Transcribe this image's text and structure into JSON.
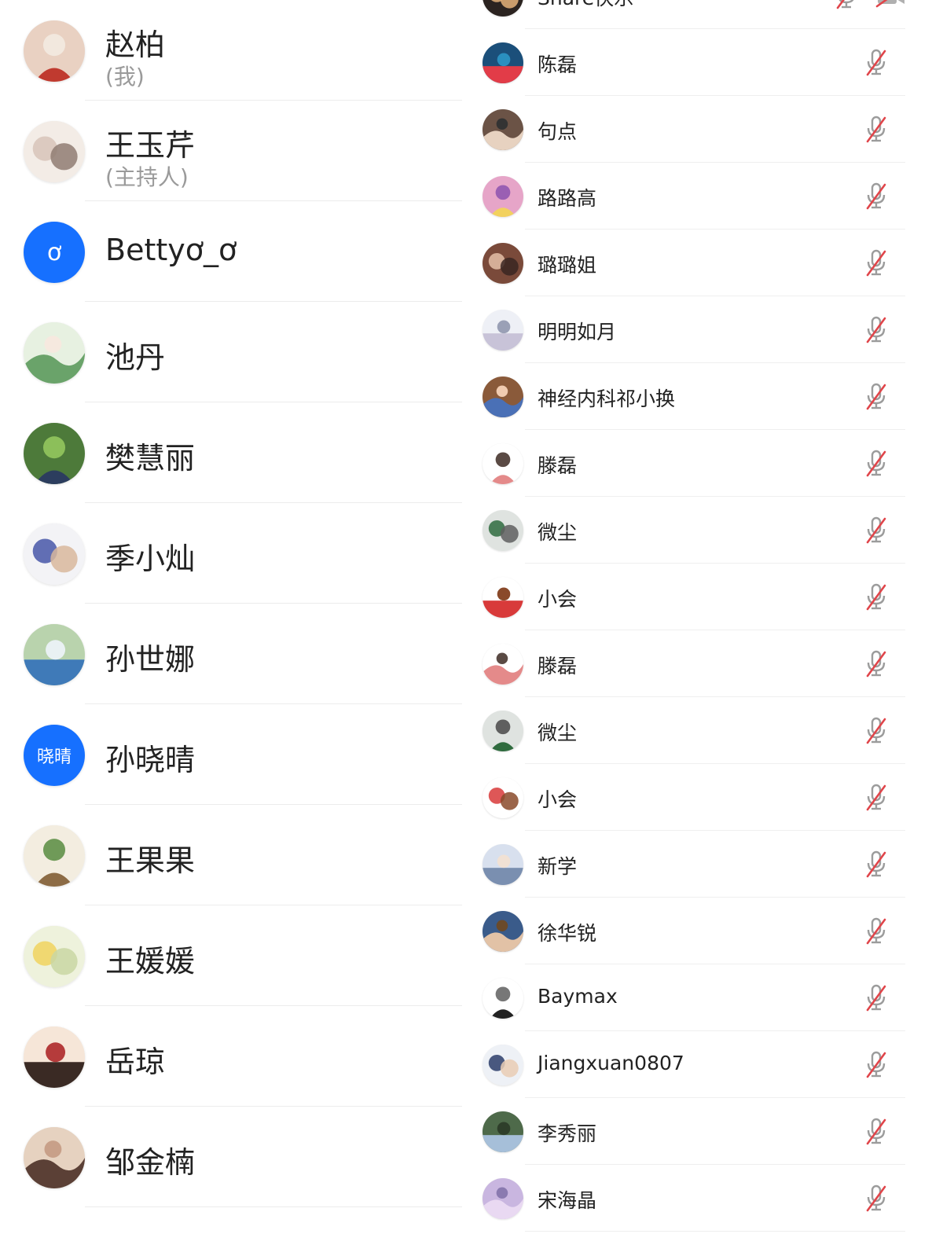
{
  "left_participants": [
    {
      "name": "赵柏",
      "role": "(我)",
      "avatar_colors": [
        "#e9d1c2",
        "#c03a2f",
        "#f2e8de"
      ]
    },
    {
      "name": "王玉芹",
      "role": "(主持人)",
      "avatar_colors": [
        "#f3ece6",
        "#d7c4b9",
        "#8f7d72"
      ]
    },
    {
      "name": "Bettyơ_ơ",
      "avatar_text": "ơ",
      "avatar_colors": [
        "#1670ff"
      ]
    },
    {
      "name": "池丹",
      "avatar_colors": [
        "#e7f1e1",
        "#6aa36a",
        "#f6e9df"
      ]
    },
    {
      "name": "樊慧丽",
      "avatar_colors": [
        "#4d7a3a",
        "#2c3d5e",
        "#8cbf5a"
      ]
    },
    {
      "name": "季小灿",
      "avatar_colors": [
        "#f3f3f6",
        "#4656a8",
        "#d8b79c"
      ]
    },
    {
      "name": "孙世娜",
      "avatar_colors": [
        "#b9d3ad",
        "#3f7ab8",
        "#e9f1f3"
      ]
    },
    {
      "name": "孙晓晴",
      "avatar_text": "晓晴",
      "avatar_colors": [
        "#1670ff"
      ]
    },
    {
      "name": "王果果",
      "avatar_colors": [
        "#f3ede0",
        "#8c6b45",
        "#6f9a58"
      ]
    },
    {
      "name": "王媛媛",
      "avatar_colors": [
        "#eef2dc",
        "#f0d35e",
        "#c9d7a3"
      ]
    },
    {
      "name": "岳琼",
      "avatar_colors": [
        "#f6e6d8",
        "#3a2a24",
        "#b53b3b"
      ]
    },
    {
      "name": "邹金楠",
      "avatar_colors": [
        "#e6d2c0",
        "#5b4036",
        "#c8a089"
      ]
    }
  ],
  "right_participants": [
    {
      "name": "Share快乐",
      "avatar_colors": [
        "#2b2320",
        "#e5b27a"
      ]
    },
    {
      "name": "陈磊",
      "avatar_colors": [
        "#1b4f7a",
        "#e23c48",
        "#2a8fbf"
      ]
    },
    {
      "name": "句点",
      "avatar_colors": [
        "#6b5346",
        "#e7d2c0",
        "#333333"
      ]
    },
    {
      "name": "路路高",
      "avatar_colors": [
        "#e6a5c8",
        "#f2d15e",
        "#9a5fb3"
      ]
    },
    {
      "name": "璐璐姐",
      "avatar_colors": [
        "#7a4a3a",
        "#e5c0a8",
        "#3a2622"
      ]
    },
    {
      "name": "明明如月",
      "avatar_colors": [
        "#eef0f6",
        "#c8c3d8",
        "#9aa0b6"
      ]
    },
    {
      "name": "神经内科祁小换",
      "avatar_colors": [
        "#8a5a3a",
        "#4a70b6",
        "#f0cbb0"
      ]
    },
    {
      "name": "滕磊",
      "avatar_colors": [
        "#ffffff",
        "#e48a8a",
        "#5a4a44"
      ]
    },
    {
      "name": "微尘",
      "avatar_colors": [
        "#dfe3e0",
        "#2f6b3e",
        "#5f5f5f"
      ]
    },
    {
      "name": "小会",
      "avatar_colors": [
        "#ffffff",
        "#d83a3a",
        "#8a4a2a"
      ]
    },
    {
      "name": "滕磊",
      "avatar_colors": [
        "#ffffff",
        "#e48a8a",
        "#5a4a44"
      ]
    },
    {
      "name": "微尘",
      "avatar_colors": [
        "#dfe3e0",
        "#2f6b3e",
        "#5f5f5f"
      ]
    },
    {
      "name": "小会",
      "avatar_colors": [
        "#ffffff",
        "#d83a3a",
        "#8a4a2a"
      ]
    },
    {
      "name": "新学",
      "avatar_colors": [
        "#d8e0ee",
        "#7a8fb0",
        "#f1e1d4"
      ]
    },
    {
      "name": "徐华锐",
      "avatar_colors": [
        "#3a5b8a",
        "#e2c2a6",
        "#6a4a2a"
      ]
    },
    {
      "name": "Baymax",
      "avatar_colors": [
        "#ffffff",
        "#222222",
        "#777777"
      ]
    },
    {
      "name": "Jiangxuan0807",
      "avatar_colors": [
        "#eef1f6",
        "#2c3d6a",
        "#e9cdb4"
      ]
    },
    {
      "name": "李秀丽",
      "avatar_colors": [
        "#4e6a4a",
        "#a6bfd9",
        "#2e3e2a"
      ]
    },
    {
      "name": "宋海晶",
      "avatar_colors": [
        "#c9b6e0",
        "#e9d9f2",
        "#8a7ab0"
      ]
    }
  ],
  "icons": {
    "mic_muted": "mic-muted-icon",
    "camera_off": "camera-off-icon"
  },
  "colors": {
    "mic_body": "#9c9c9c",
    "mute_slash": "#e0454a",
    "accent_blue": "#1670ff",
    "divider": "#ececec"
  }
}
